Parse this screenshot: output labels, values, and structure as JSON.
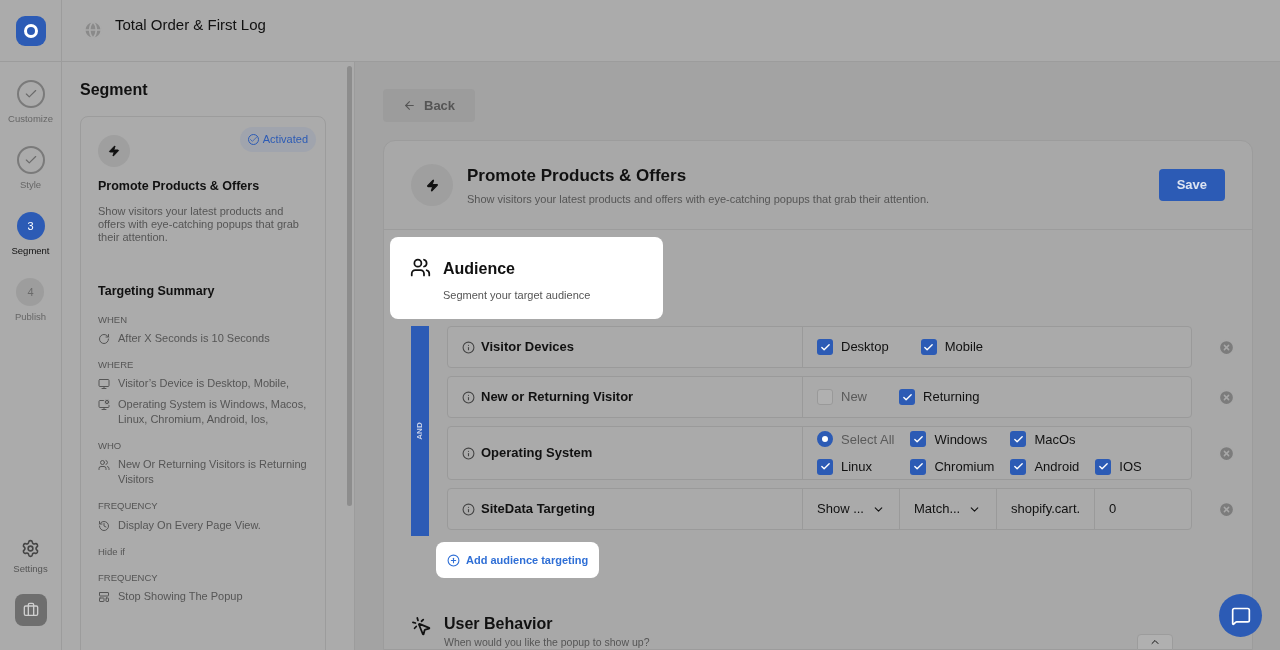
{
  "header": {
    "title": "Total Order & First Log"
  },
  "steps": [
    {
      "label": "Customize",
      "done": true,
      "selected": false
    },
    {
      "label": "Style",
      "done": true,
      "selected": false
    },
    {
      "label": "Segment",
      "number": "3",
      "done": false,
      "selected": true
    },
    {
      "label": "Publish",
      "number": "4",
      "done": false,
      "selected": false
    }
  ],
  "rail_bottom": {
    "settings_label": "Settings"
  },
  "sidebar": {
    "title": "Segment",
    "card": {
      "badge": "Activated",
      "title": "Promote Products & Offers",
      "description": "Show visitors your latest products and offers with eye-catching popups that grab their attention.",
      "summary_title": "Targeting Summary",
      "blocks": [
        {
          "kind": "caption",
          "text": "WHEN"
        },
        {
          "kind": "entry",
          "text": "After X Seconds is 10 Seconds"
        },
        {
          "kind": "caption",
          "text": "WHERE"
        },
        {
          "kind": "entry",
          "text": "Visitor’s Device is Desktop, Mobile,"
        },
        {
          "kind": "entry",
          "text": "Operating System is Windows, Macos, Linux, Chromium, Android, Ios,"
        },
        {
          "kind": "caption",
          "text": "WHO"
        },
        {
          "kind": "entry",
          "text": "New Or Returning Visitors is Returning Visitors"
        },
        {
          "kind": "caption",
          "text": "FREQUENCY"
        },
        {
          "kind": "entry",
          "text": "Display On Every Page View."
        },
        {
          "kind": "label",
          "text": "Hide if"
        },
        {
          "kind": "caption",
          "text": "FREQUENCY"
        },
        {
          "kind": "entry",
          "text": "Stop Showing The Popup"
        }
      ]
    }
  },
  "main": {
    "back": "Back",
    "title": "Promote Products & Offers",
    "description": "Show visitors your latest products and offers with eye-catching popups that grab their attention.",
    "save": "Save",
    "audience": {
      "title": "Audience",
      "subtitle": "Segment your target audience",
      "connector": "AND",
      "rules": [
        {
          "kind": "options",
          "label": "Visitor Devices",
          "option_rows": [
            [
              {
                "kind": "checkbox",
                "label": "Desktop",
                "checked": true
              },
              {
                "kind": "checkbox",
                "label": "Mobile",
                "checked": true
              }
            ]
          ]
        },
        {
          "kind": "options",
          "label": "New or Returning Visitor",
          "option_rows": [
            [
              {
                "kind": "checkbox",
                "label": "New",
                "checked": false
              },
              {
                "kind": "checkbox",
                "label": "Returning",
                "checked": true
              }
            ]
          ]
        },
        {
          "kind": "options",
          "label": "Operating System",
          "option_rows": [
            [
              {
                "kind": "radio",
                "label": "Select All",
                "checked": true
              },
              {
                "kind": "checkbox",
                "label": "Windows",
                "checked": true
              },
              {
                "kind": "checkbox",
                "label": "MacOs",
                "checked": true
              }
            ],
            [
              {
                "kind": "checkbox",
                "label": "Linux",
                "checked": true
              },
              {
                "kind": "checkbox",
                "label": "Chromium",
                "checked": true
              },
              {
                "kind": "checkbox",
                "label": "Android",
                "checked": true
              },
              {
                "kind": "checkbox",
                "label": "IOS",
                "checked": true
              }
            ]
          ]
        },
        {
          "kind": "fields",
          "label": "SiteData Targeting",
          "fields": [
            {
              "kind": "dropdown",
              "value": "Show ..."
            },
            {
              "kind": "dropdown",
              "value": "Match..."
            },
            {
              "kind": "text",
              "value": "shopify.cart."
            },
            {
              "kind": "text",
              "value": "0"
            }
          ]
        }
      ],
      "add": "Add audience targeting"
    },
    "behavior": {
      "title": "User Behavior",
      "subtitle": "When would you like the popup to show up?"
    }
  }
}
